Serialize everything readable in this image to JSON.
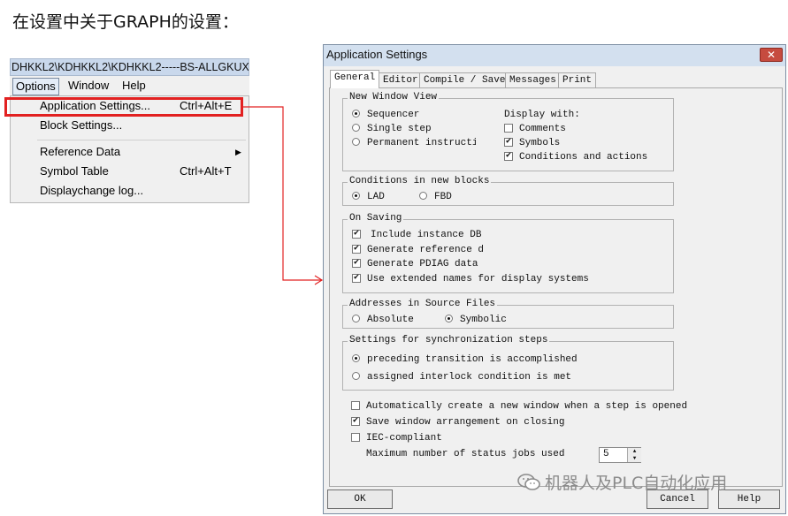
{
  "caption": "在设置中关于GRAPH的设置：",
  "left_window": {
    "title_text": "DHKKL2\\KDHKKL2\\KDHKKL2-----BS-ALLGKUX\\",
    "menubar": {
      "options": "Options",
      "window": "Window",
      "help": "Help"
    },
    "dropdown": [
      {
        "label": "Application Settings...",
        "shortcut": "Ctrl+Alt+E"
      },
      {
        "label": "Block Settings...",
        "shortcut": ""
      },
      {
        "label": "Reference Data",
        "shortcut": ""
      },
      {
        "label": "Symbol Table",
        "shortcut": "Ctrl+Alt+T"
      },
      {
        "label": "Displaychange log...",
        "shortcut": ""
      }
    ],
    "highlight_color": "#e22121"
  },
  "dialog": {
    "title": "Application Settings",
    "close_glyph": "✕",
    "tabs": [
      "General",
      "Editor",
      "Compile / Save",
      "Messages",
      "Print"
    ],
    "new_window_view": {
      "title": "New Window View",
      "options": [
        "Sequencer",
        "Single step",
        "Permanent instructior"
      ],
      "selected": "Sequencer",
      "display_with_label": "Display with:",
      "display_with": [
        {
          "label": "Comments",
          "checked": false
        },
        {
          "label": "Symbols",
          "checked": true
        },
        {
          "label": "Conditions and actions",
          "checked": true
        }
      ]
    },
    "conditions": {
      "title": "Conditions in new blocks",
      "options": [
        "LAD",
        "FBD"
      ],
      "selected": "LAD"
    },
    "on_saving": {
      "title": "On Saving",
      "items": [
        {
          "label": "Include instance DB",
          "checked": true
        },
        {
          "label": "Generate reference d",
          "checked": true
        },
        {
          "label": "Generate PDIAG data",
          "checked": true
        },
        {
          "label": "Use extended names for display systems",
          "checked": true
        }
      ]
    },
    "addresses": {
      "title": "Addresses in Source Files",
      "options": [
        "Absolute",
        "Symbolic"
      ],
      "selected": "Symbolic"
    },
    "sync": {
      "title": "Settings for synchronization steps",
      "options": [
        "preceding transition is accomplished",
        "assigned interlock condition is met"
      ],
      "selected": "preceding transition is accomplished"
    },
    "misc": [
      {
        "label": "Automatically create a new window when a step is opened",
        "checked": false
      },
      {
        "label": "Save window arrangement on closing",
        "checked": true
      },
      {
        "label": "IEC-compliant",
        "checked": false
      }
    ],
    "max_jobs_label": "Maximum number of status jobs used",
    "max_jobs_value": "5",
    "buttons": {
      "ok": "OK",
      "cancel": "Cancel",
      "help": "Help"
    }
  },
  "watermark": "机器人及PLC自动化应用",
  "check_glyph": "✔"
}
